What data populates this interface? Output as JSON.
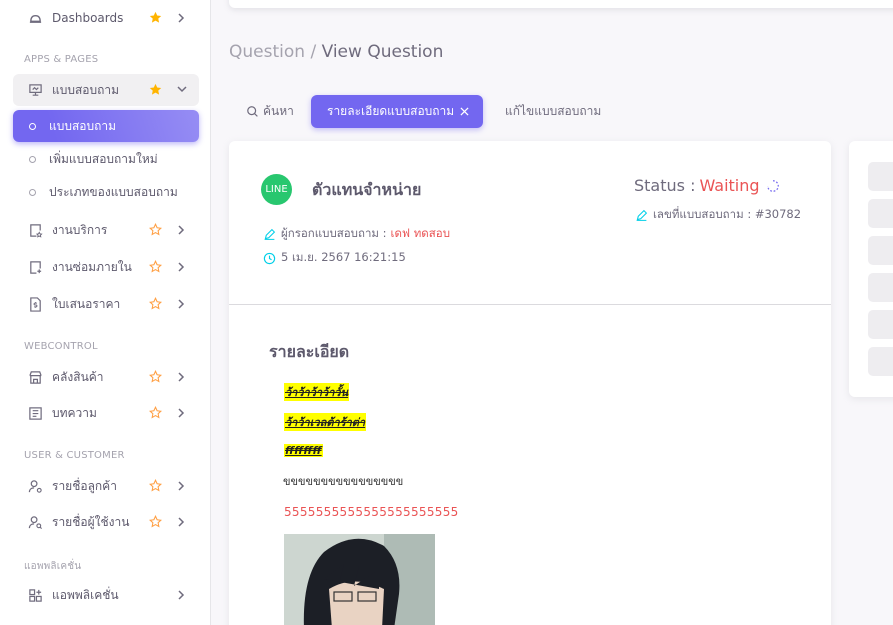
{
  "sidebar": {
    "dashboards": "Dashboards",
    "section_apps": "APPS & PAGES",
    "survey_group": "แบบสอบถาม",
    "sub_items": [
      "แบบสอบถาม",
      "เพิ่มแบบสอบถามใหม่",
      "ประเภทของแบบสอบถาม"
    ],
    "services": "งานบริการ",
    "internal_repair": "งานซ่อมภายใน",
    "quotation": "ใบเสนอราคา",
    "section_webcontrol": "WEBCONTROL",
    "warehouse": "คลังสินค้า",
    "articles": "บทความ",
    "section_user": "USER & CUSTOMER",
    "customers": "รายชื่อลูกค้า",
    "users": "รายชื่อผู้ใช้งาน",
    "section_apps2": "แอพพลิเคชั่น",
    "applications": "แอพพลิเคชั่น"
  },
  "breadcrumb": {
    "parent": "Question /",
    "current": "View Question"
  },
  "tabs": {
    "search": "ค้นหา",
    "details": "รายละเอียดแบบสอบถาม",
    "edit": "แก้ไขแบบสอบถาม"
  },
  "question": {
    "channel": "LINE",
    "customer": "ตัวแทนจำหน่าย",
    "filler_label": "ผู้กรอกแบบสอบถาม :",
    "filler_name": "เดฟ ทดสอบ",
    "datetime": "5 เม.ย. 2567 16:21:15",
    "status_label": "Status :",
    "status_value": "Waiting",
    "number_label": "เลขที่แบบสอบถาม : #30782"
  },
  "detail": {
    "heading": "รายละเอียด",
    "highlights": [
      "ว้าว้าว้าว้าวั้น",
      "ว้าว้าเวลต้าร้าต่า",
      "ffffffff"
    ],
    "plain_text": "ขขขขขขขขขขขขขขขข",
    "red_text": "5555555555555555555555"
  },
  "colors": {
    "primary": "#7367f0",
    "danger": "#ea5455",
    "success": "#28c76f",
    "warning": "#ff9f43",
    "star": "#ffb400"
  }
}
